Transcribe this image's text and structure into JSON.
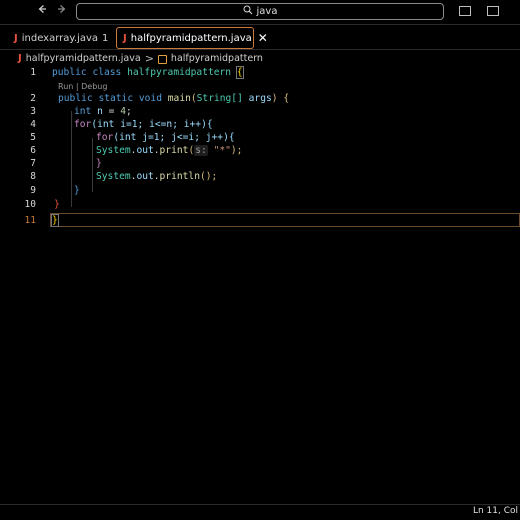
{
  "titlebar": {
    "back_icon": "arrow-left-icon",
    "forward_icon": "arrow-right-icon",
    "search_text": "java",
    "search_icon": "search-icon"
  },
  "tabs": [
    {
      "label": "indexarray.java",
      "badge": "1",
      "icon": "J",
      "active": false
    },
    {
      "label": "halfpyramidpattern.java",
      "icon": "J",
      "active": true,
      "close": "✕"
    }
  ],
  "breadcrumb": {
    "file": "halfpyramidpattern.java",
    "separator": ">",
    "symbol": "halfpyramidpattern"
  },
  "editor": {
    "codelens": "Run | Debug",
    "line_numbers": [
      "1",
      "2",
      "3",
      "4",
      "5",
      "6",
      "7",
      "8",
      "9",
      "10",
      "11"
    ],
    "lines": {
      "l1_kw1": "public",
      "l1_kw2": "class",
      "l1_name": "halfpyramidpattern",
      "l1_brace": "{",
      "l2_kw1": "public",
      "l2_kw2": "static",
      "l2_kw3": "void",
      "l2_fn": "main",
      "l2_open": "(",
      "l2_type": "String[]",
      "l2_arg": "args",
      "l2_close": ")",
      "l2_brace": "{",
      "l3_type": "int",
      "l3_var": "n",
      "l3_eq": " = ",
      "l3_num": "4",
      "l3_semi": ";",
      "l4_for": "for",
      "l4_rest": "(int i=1; i<=n; i++){",
      "l5_for": "for",
      "l5_rest": "(int j=1; j<=i; j++){",
      "l6_sys": "System",
      "l6_dot1": ".",
      "l6_out": "out",
      "l6_dot2": ".",
      "l6_fn": "print",
      "l6_open": "(",
      "l6_hint": "s:",
      "l6_str": "\"*\"",
      "l6_close": ");",
      "l7_brace": "}",
      "l8_sys": "System",
      "l8_dot1": ".",
      "l8_out": "out",
      "l8_dot2": ".",
      "l8_fn": "println",
      "l8_rest": "();",
      "l9_brace": "}",
      "l10_brace": "}",
      "l11_brace": "}"
    }
  },
  "status": {
    "position": "Ln 11, Col"
  }
}
